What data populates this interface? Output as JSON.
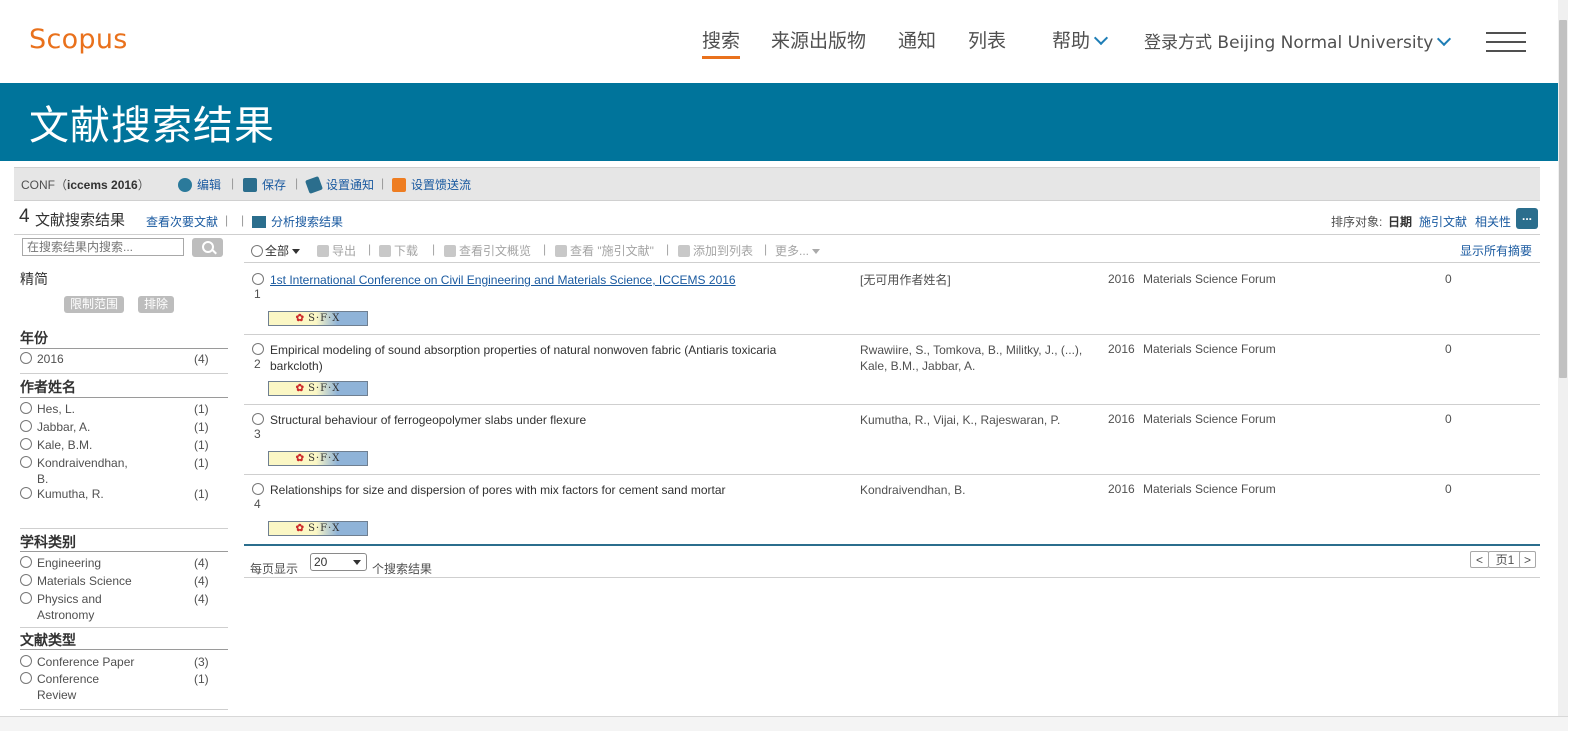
{
  "header": {
    "logo": "Scopus",
    "nav": [
      "搜索",
      "来源出版物",
      "通知",
      "列表",
      "帮助"
    ],
    "login": "登录方式 Beijing Normal University"
  },
  "banner": {
    "title": "文献搜索结果"
  },
  "query": {
    "prefix": "CONF（",
    "term": "iccems  2016",
    "suffix": "）",
    "actions": [
      "编辑",
      "保存",
      "设置通知",
      "设置馈送流"
    ]
  },
  "results_header": {
    "count": "4",
    "label": "文献搜索结果",
    "secondary_docs": "查看次要文献",
    "analyze": "分析搜索结果",
    "sort_label": "排序对象:",
    "sort_options": [
      "日期",
      "施引文献",
      "相关性"
    ],
    "more": "..."
  },
  "sidebar": {
    "search_placeholder": "在搜索结果内搜索...",
    "refine": "精简",
    "limit": "限制范围",
    "exclude": "排除",
    "facets": [
      {
        "title": "年份",
        "items": [
          {
            "label": "2016",
            "count": "(4)"
          }
        ]
      },
      {
        "title": "作者姓名",
        "items": [
          {
            "label": "Hes, L.",
            "count": "(1)"
          },
          {
            "label": "Jabbar, A.",
            "count": "(1)"
          },
          {
            "label": "Kale, B.M.",
            "count": "(1)"
          },
          {
            "label": "Kondraivendhan, B.",
            "count": "(1)"
          },
          {
            "label": "Kumutha, R.",
            "count": "(1)"
          }
        ]
      },
      {
        "title": "学科类别",
        "items": [
          {
            "label": "Engineering",
            "count": "(4)"
          },
          {
            "label": "Materials Science",
            "count": "(4)"
          },
          {
            "label": "Physics and Astronomy",
            "count": "(4)"
          }
        ]
      },
      {
        "title": "文献类型",
        "items": [
          {
            "label": "Conference Paper",
            "count": "(3)"
          },
          {
            "label": "Conference Review",
            "count": "(1)"
          }
        ]
      }
    ]
  },
  "toolbar": {
    "select_all": "全部",
    "export": "导出",
    "download": "下载",
    "citation_overview": "查看引文概览",
    "cited_by": "查看 \"施引文献\"",
    "add_to_list": "添加到列表",
    "more": "更多...",
    "show_abstracts": "显示所有摘要"
  },
  "results": [
    {
      "num": "1",
      "title": "1st International Conference on Civil Engineering and Materials Science, ICCEMS 2016",
      "authors": "[无可用作者姓名]",
      "year": "2016",
      "source": "Materials Science Forum",
      "cites": "0",
      "sfx": "S·F·X"
    },
    {
      "num": "2",
      "title": "Empirical modeling of sound absorption properties of natural nonwoven fabric (Antiaris toxicaria barkcloth)",
      "authors": "Rwawiire, S., Tomkova, B., Militky, J., (...), Kale, B.M., Jabbar, A.",
      "year": "2016",
      "source": "Materials Science Forum",
      "cites": "0",
      "sfx": "S·F·X"
    },
    {
      "num": "3",
      "title": "Structural behaviour of ferrogeopolymer slabs under flexure",
      "authors": "Kumutha, R., Vijai, K., Rajeswaran, P.",
      "year": "2016",
      "source": "Materials Science Forum",
      "cites": "0",
      "sfx": "S·F·X"
    },
    {
      "num": "4",
      "title": "Relationships for size and dispersion of pores with mix factors for cement sand mortar",
      "authors": "Kondraivendhan, B.",
      "year": "2016",
      "source": "Materials Science Forum",
      "cites": "0",
      "sfx": "S·F·X"
    }
  ],
  "pager": {
    "per_page_label": "每页显示",
    "per_page_value": "20",
    "per_page_suffix": "个搜索结果",
    "page_label": "页",
    "page_number": "1"
  },
  "colors": {
    "brand_orange": "#e9711c",
    "banner_blue": "#00749b",
    "link_blue": "#1a5aa0"
  }
}
